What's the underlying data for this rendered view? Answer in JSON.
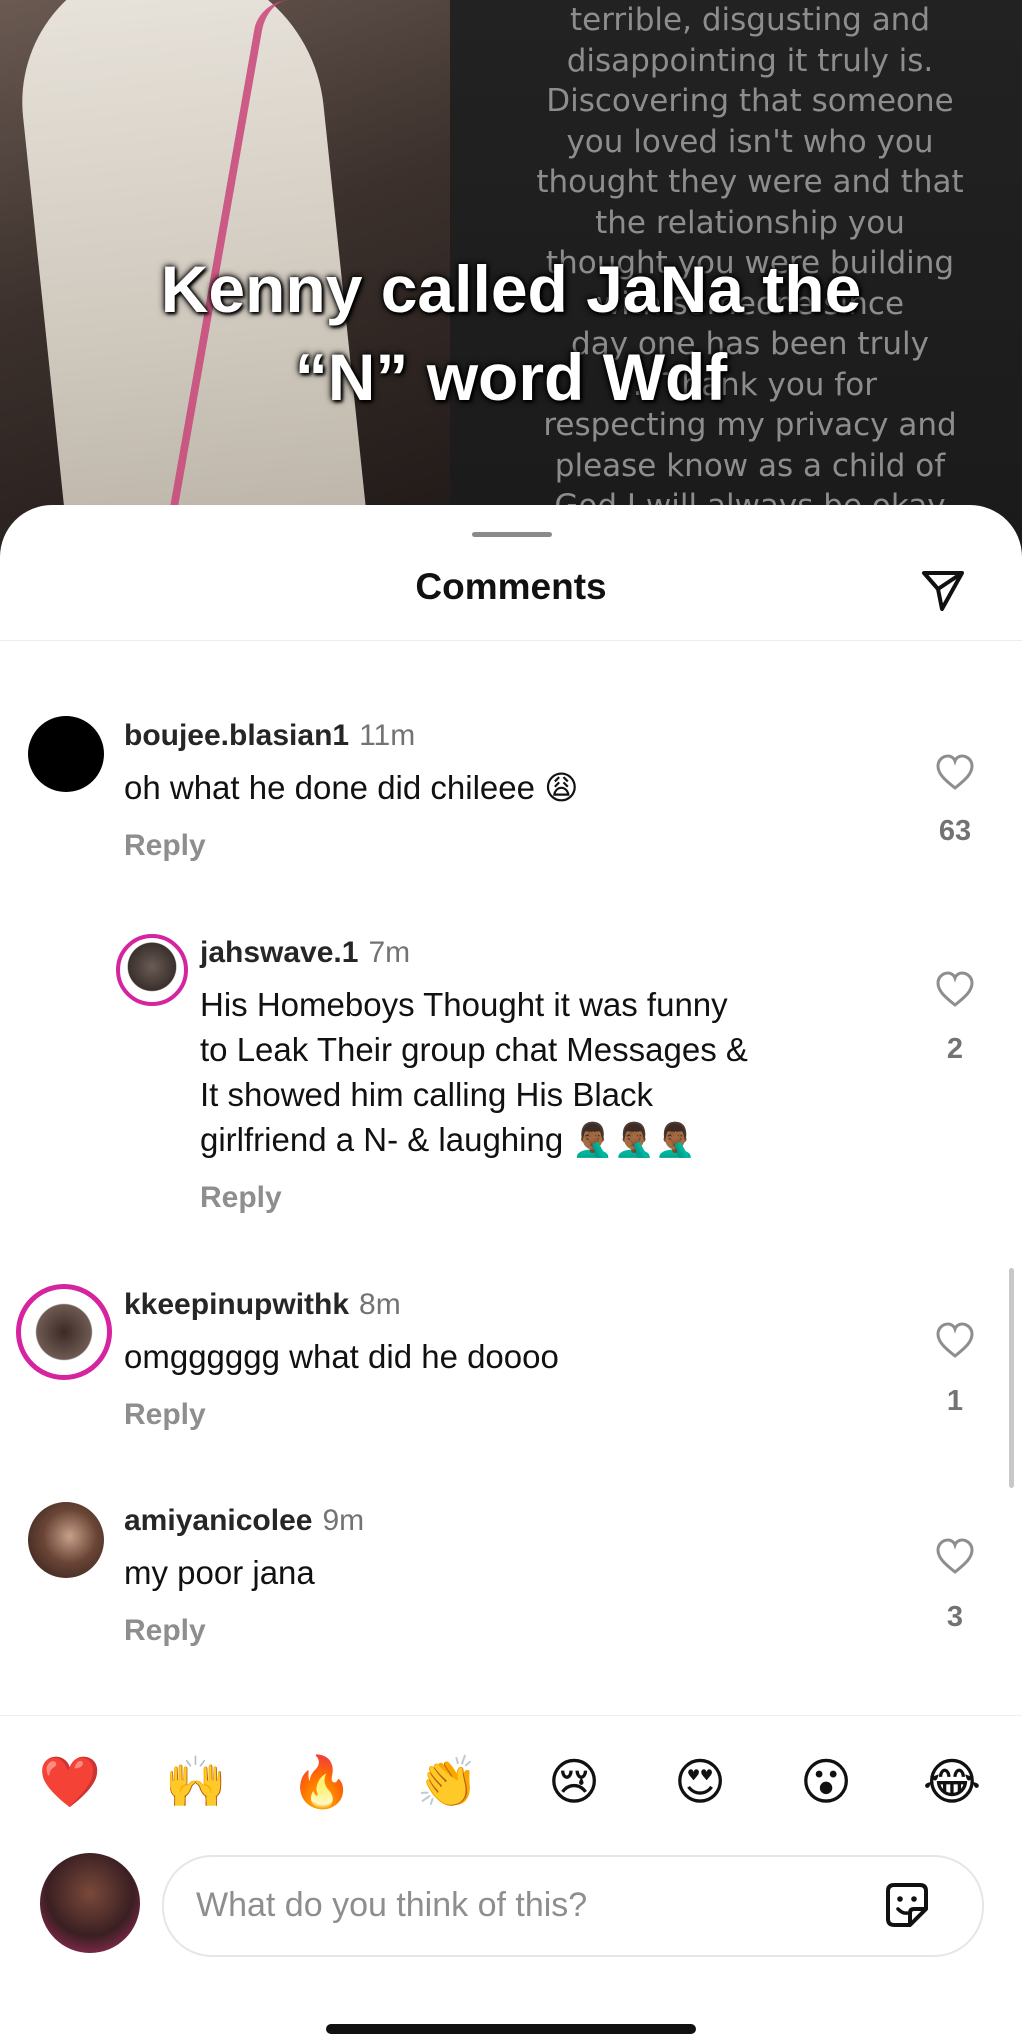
{
  "background_text_lines": [
    "terrible, disgusting and",
    "disappointing it truly is.",
    "Discovering that someone",
    "you loved isn't who you",
    "thought they were and that",
    "the relationship you",
    "thought you were building",
    "with someone since",
    "day one has been truly",
    "... Thank you for",
    "respecting my privacy and",
    "please know as a child of",
    "God I will always be okay"
  ],
  "overlay_caption": {
    "line1": "Kenny called JaNa the",
    "line2": "“N” word Wdf"
  },
  "sheet": {
    "title": "Comments",
    "share_icon": "send-icon"
  },
  "comments": [
    {
      "username": "boujee.blasian1",
      "time": "11m",
      "text": "oh what he done did chileee 😩",
      "reply_label": "Reply",
      "likes": "63",
      "avatar_color": "#000000"
    },
    {
      "username": "jahswave.1",
      "time": "7m",
      "text_lines": [
        "His Homeboys Thought it was funny",
        "to Leak Their group chat Messages &",
        "It showed him calling His Black",
        "girlfriend a N- & laughing 🤦🏾‍♂️🤦🏾‍♂️🤦🏾‍♂️"
      ],
      "reply_label": "Reply",
      "likes": "2"
    },
    {
      "username": "kkeepinupwithk",
      "time": "8m",
      "text": "omgggggg what did he doooo",
      "reply_label": "Reply",
      "likes": "1"
    },
    {
      "username": "amiyanicolee",
      "time": "9m",
      "text": "my poor jana",
      "reply_label": "Reply",
      "likes": "3"
    }
  ],
  "quick_reactions": [
    "❤️",
    "🙌",
    "🔥",
    "👏",
    "😢",
    "😍",
    "😮",
    "😂"
  ],
  "composer": {
    "placeholder": "What do you think of this?",
    "sticker_icon": "sticker-icon"
  },
  "colors": {
    "story_ring": "#d6249f",
    "story_ring_2": "#fdcb52",
    "pink_accent": "#c9467a"
  }
}
